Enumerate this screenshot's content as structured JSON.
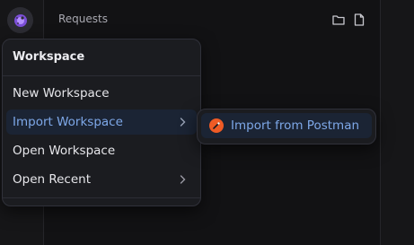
{
  "header": {
    "title": "Requests",
    "icons": [
      "folder-icon",
      "file-icon"
    ]
  },
  "app": {
    "logo_icon": "app-logo-icon",
    "accent": "#8a63e6"
  },
  "workspace_menu": {
    "title": "Workspace",
    "items": [
      {
        "label": "New Workspace",
        "has_submenu": false
      },
      {
        "label": "Import Workspace",
        "has_submenu": true,
        "active": true
      },
      {
        "label": "Open Workspace",
        "has_submenu": false
      },
      {
        "label": "Open Recent",
        "has_submenu": true
      }
    ]
  },
  "submenu": {
    "items": [
      {
        "label": "Import from Postman",
        "icon": "postman-icon",
        "icon_color": "#ef5b25"
      }
    ]
  },
  "colors": {
    "active_text": "#7ea8e8",
    "active_bg": "#1b2434",
    "menu_bg": "#1b1c20"
  }
}
